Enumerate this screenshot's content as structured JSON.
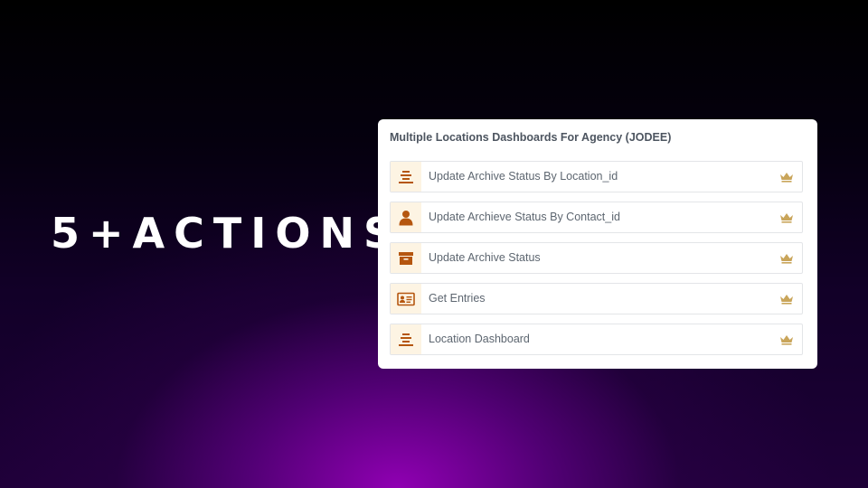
{
  "headline": "5+ACTIONS",
  "card": {
    "title": "Multiple Locations Dashboards For Agency (JODEE)",
    "items": [
      {
        "label": "Update Archive Status By Location_id",
        "icon": "stack-layers-icon"
      },
      {
        "label": "Update Archieve Status By Contact_id",
        "icon": "user-icon"
      },
      {
        "label": "Update Archive Status",
        "icon": "archive-box-icon"
      },
      {
        "label": "Get Entries",
        "icon": "id-card-icon"
      },
      {
        "label": "Location Dashboard",
        "icon": "stack-layers-icon"
      }
    ]
  },
  "colors": {
    "icon": "#b5560f",
    "icon_bg": "#fdf4e3",
    "crown": "#c9a55a",
    "card_bg": "#ffffff"
  }
}
